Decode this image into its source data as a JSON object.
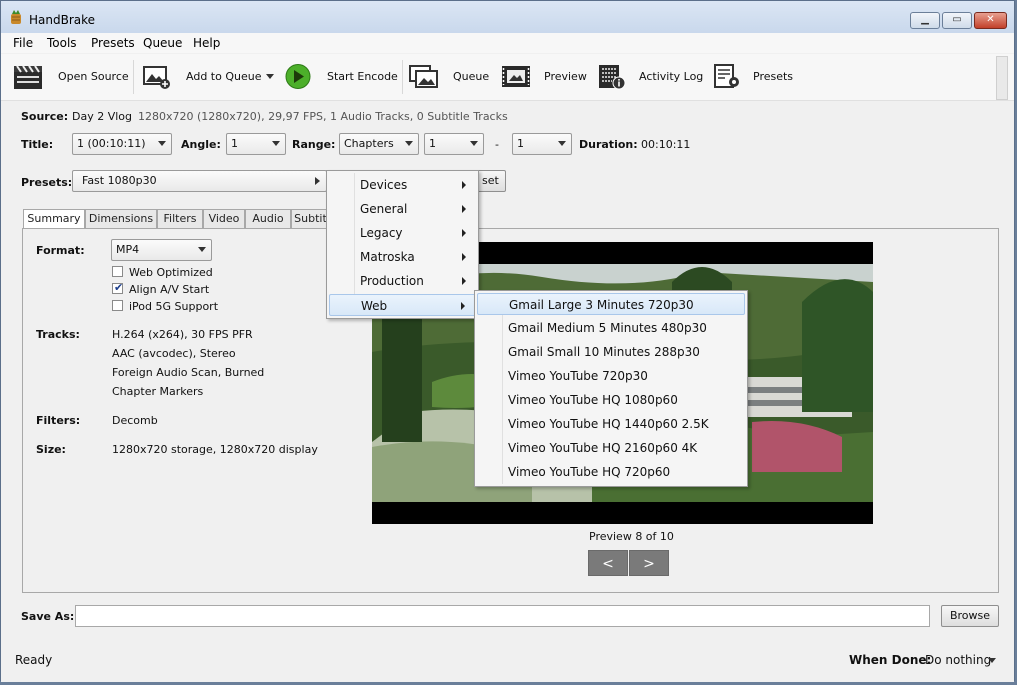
{
  "window": {
    "title": "HandBrake"
  },
  "menubar": [
    "File",
    "Tools",
    "Presets",
    "Queue",
    "Help"
  ],
  "toolbar": {
    "open_source": "Open Source",
    "add_to_queue": "Add to Queue",
    "start_encode": "Start Encode",
    "queue": "Queue",
    "preview": "Preview",
    "activity_log": "Activity Log",
    "presets": "Presets"
  },
  "source": {
    "label": "Source:",
    "name": "Day 2 Vlog",
    "details": "1280x720 (1280x720), 29,97 FPS, 1 Audio Tracks, 0 Subtitle Tracks"
  },
  "title_row": {
    "title_label": "Title:",
    "title_value": "1 (00:10:11)",
    "angle_label": "Angle:",
    "angle_value": "1",
    "range_label": "Range:",
    "range_mode": "Chapters",
    "range_start": "1",
    "range_sep": "-",
    "range_end": "1",
    "duration_label": "Duration:",
    "duration_value": "00:10:11"
  },
  "presets_row": {
    "label": "Presets:",
    "value": "Fast 1080p30",
    "button_partial": "set"
  },
  "tabs": [
    "Summary",
    "Dimensions",
    "Filters",
    "Video",
    "Audio",
    "Subtitl"
  ],
  "summary": {
    "format_label": "Format:",
    "format_value": "MP4",
    "checkboxes": [
      {
        "label": "Web Optimized",
        "checked": false
      },
      {
        "label": "Align A/V Start",
        "checked": true
      },
      {
        "label": "iPod 5G Support",
        "checked": false
      }
    ],
    "tracks_label": "Tracks:",
    "tracks": [
      "H.264 (x264), 30 FPS PFR",
      "AAC (avcodec), Stereo",
      "Foreign Audio Scan, Burned",
      "Chapter Markers"
    ],
    "filters_label": "Filters:",
    "filters_value": "Decomb",
    "size_label": "Size:",
    "size_value": "1280x720 storage, 1280x720 display"
  },
  "preview": {
    "caption": "Preview 8 of 10",
    "prev": "<",
    "next": ">"
  },
  "save_as": {
    "label": "Save As:",
    "value": "",
    "browse": "Browse"
  },
  "status": {
    "text": "Ready",
    "when_done_label": "When Done:",
    "when_done_value": "Do nothing"
  },
  "presets_menu": {
    "categories": [
      "Devices",
      "General",
      "Legacy",
      "Matroska",
      "Production",
      "Web"
    ],
    "highlighted": "Web",
    "web_submenu": [
      "Gmail Large 3 Minutes 720p30",
      "Gmail Medium 5 Minutes 480p30",
      "Gmail Small 10 Minutes 288p30",
      "Vimeo YouTube 720p30",
      "Vimeo YouTube HQ 1080p60",
      "Vimeo YouTube HQ 1440p60 2.5K",
      "Vimeo YouTube HQ 2160p60 4K",
      "Vimeo YouTube HQ 720p60"
    ],
    "submenu_highlighted": "Gmail Large 3 Minutes 720p30"
  },
  "colors": {
    "start_encode_green": "#4caf2a",
    "menu_highlight": "#d8e8f8",
    "nav_button": "#7a7a7a"
  }
}
